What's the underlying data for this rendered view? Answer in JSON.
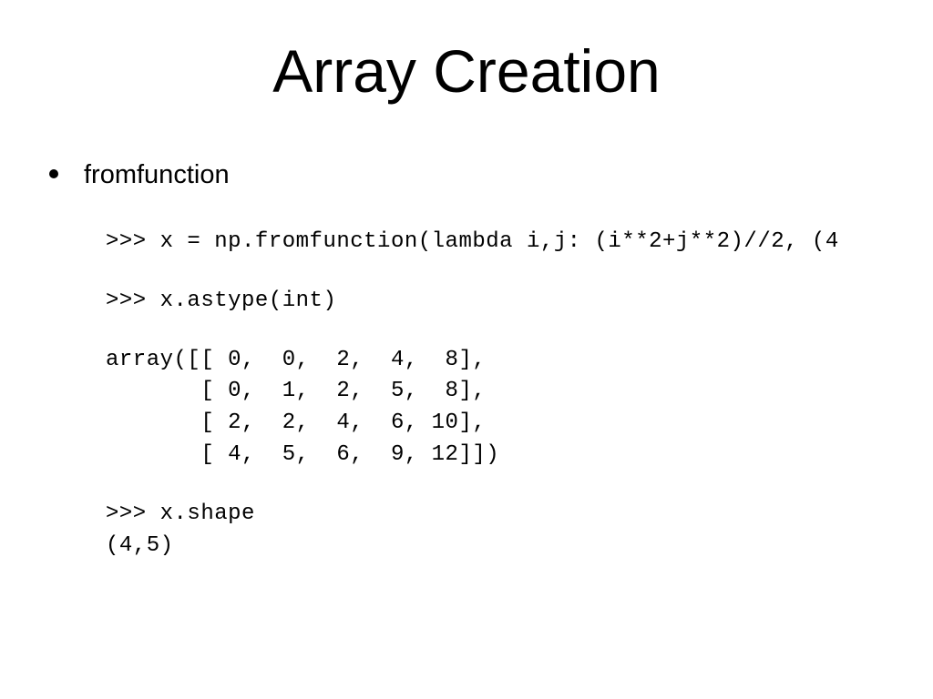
{
  "title": "Array Creation",
  "bullet": "fromfunction",
  "code": {
    "line1": ">>> x = np.fromfunction(lambda i,j: (i**2+j**2)//2, (4",
    "line2": ">>> x.astype(int)",
    "array": "array([[ 0,  0,  2,  4,  8],\n       [ 0,  1,  2,  5,  8],\n       [ 2,  2,  4,  6, 10],\n       [ 4,  5,  6,  9, 12]])",
    "line3": ">>> x.shape\n(4,5)"
  }
}
